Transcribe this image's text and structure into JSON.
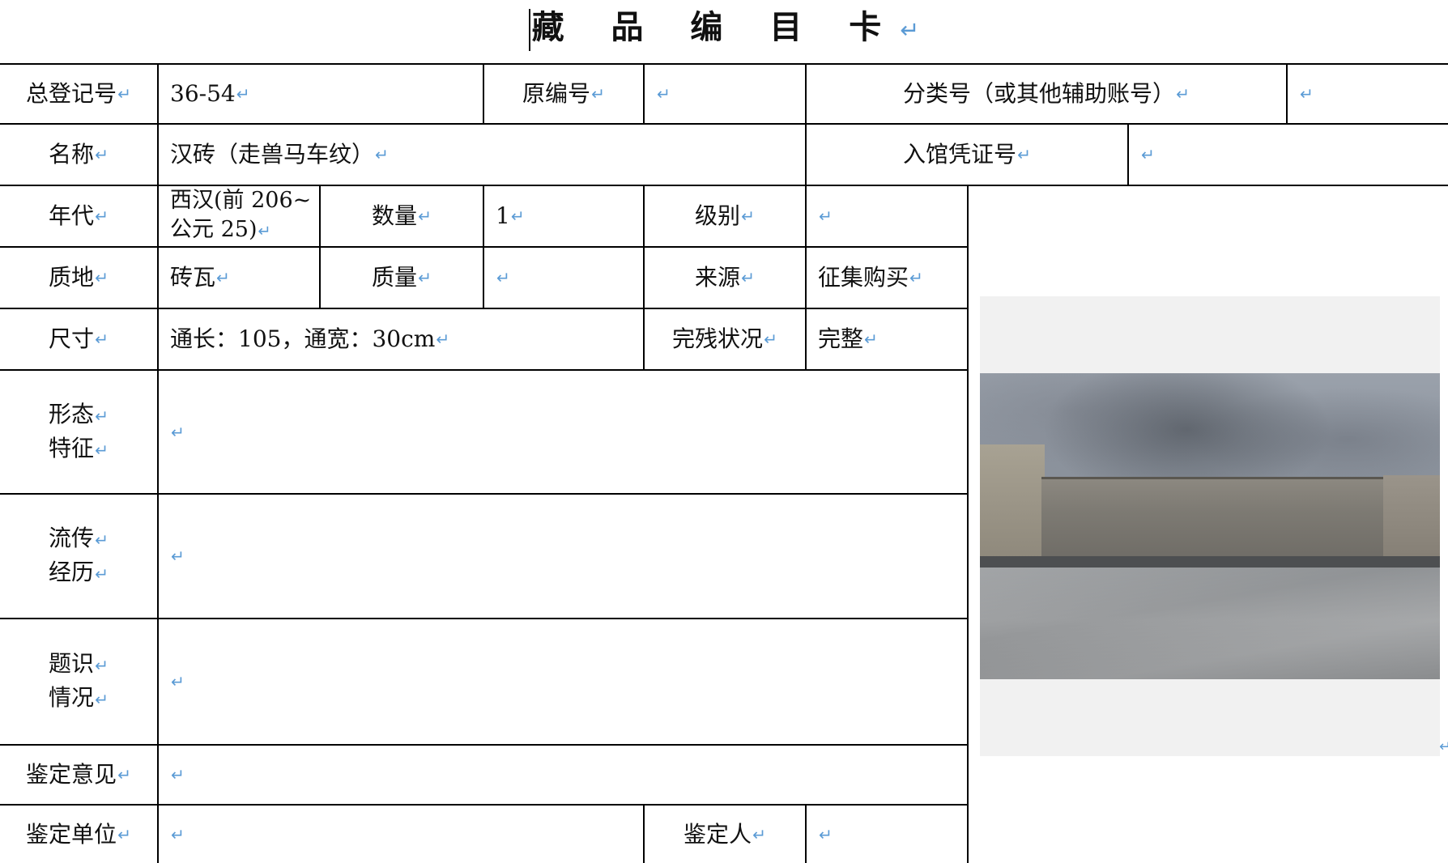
{
  "title": "藏 品 编 目 卡",
  "paragraph_mark": "↵",
  "row1": {
    "reg_label": "总登记号",
    "reg_value": "36-54",
    "orig_label": "原编号",
    "orig_value": "",
    "class_label": "分类号（或其他辅助账号）",
    "class_value": ""
  },
  "row2": {
    "name_label": "名称",
    "name_value": "汉砖（走兽马车纹）",
    "voucher_label": "入馆凭证号",
    "voucher_value": ""
  },
  "row3": {
    "era_label": "年代",
    "era_value_line1": "西汉(前 206~",
    "era_value_line2": "公元 25)",
    "qty_label": "数量",
    "qty_value": "1",
    "grade_label": "级别",
    "grade_value": ""
  },
  "row4": {
    "material_label": "质地",
    "material_value": "砖瓦",
    "mass_label": "质量",
    "mass_value": "",
    "source_label": "来源",
    "source_value": "征集购买"
  },
  "row5": {
    "size_label": "尺寸",
    "size_value": "通长：105，通宽：30cm",
    "condition_label": "完残状况",
    "condition_value": "完整"
  },
  "row6": {
    "label_line1": "形态",
    "label_line2": "特征",
    "value": ""
  },
  "row7": {
    "label_line1": "流传",
    "label_line2": "经历",
    "value": ""
  },
  "row8": {
    "label_line1": "题识",
    "label_line2": "情况",
    "value": ""
  },
  "row9": {
    "label": "鉴定意见",
    "value": ""
  },
  "row10": {
    "unit_label": "鉴定单位",
    "unit_value": "",
    "appraiser_label": "鉴定人",
    "appraiser_value": ""
  },
  "photo": {
    "icon": "brick-photo-icon"
  }
}
